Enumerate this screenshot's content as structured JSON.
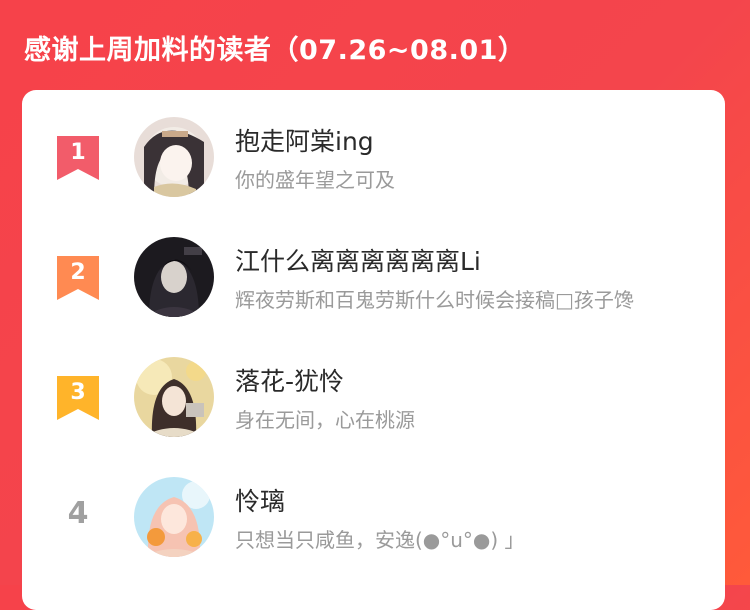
{
  "header": {
    "title": "感谢上周加料的读者（07.26~08.01）"
  },
  "colors": {
    "background": "#f4454c",
    "rank1": "#f25c6a",
    "rank2": "#ff8a52",
    "rank3": "#ffb42a",
    "rank_plain": "#a0a0a0"
  },
  "readers": [
    {
      "rank": "1",
      "name": "抱走阿棠ing",
      "subtitle": "你的盛年望之可及"
    },
    {
      "rank": "2",
      "name": "江什么离离离离离离Li",
      "subtitle": "辉夜劳斯和百鬼劳斯什么时候会接稿□孩子馋"
    },
    {
      "rank": "3",
      "name": "落花-犹怜",
      "subtitle": "身在无间，心在桃源"
    },
    {
      "rank": "4",
      "name": "怜璃",
      "subtitle": "只想当只咸鱼，安逸(●°u°●) 」"
    }
  ]
}
